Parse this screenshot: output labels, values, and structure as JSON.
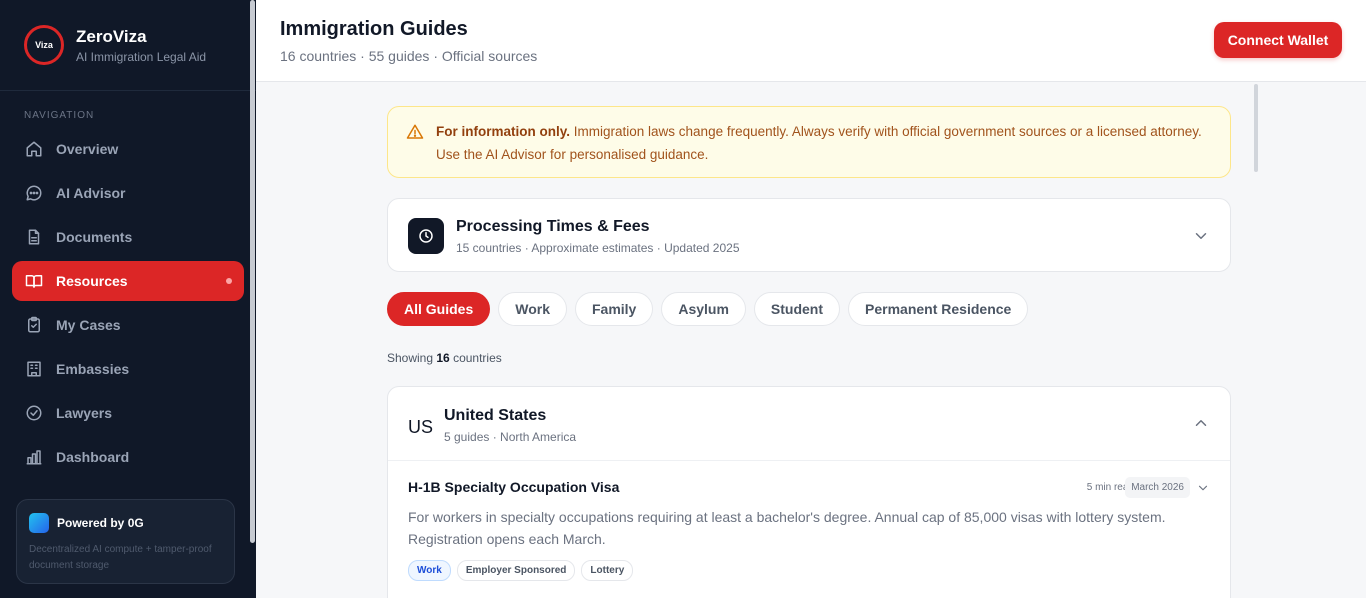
{
  "sidebar": {
    "logo_text": "Viza",
    "brand_name": "ZeroViza",
    "brand_sub": "AI Immigration Legal Aid",
    "nav_heading": "NAVIGATION",
    "items": [
      {
        "label": "Overview",
        "icon": "home-icon"
      },
      {
        "label": "AI Advisor",
        "icon": "chat-icon"
      },
      {
        "label": "Documents",
        "icon": "document-icon"
      },
      {
        "label": "Resources",
        "icon": "book-icon",
        "active": true
      },
      {
        "label": "My Cases",
        "icon": "clipboard-icon"
      },
      {
        "label": "Embassies",
        "icon": "building-icon"
      },
      {
        "label": "Lawyers",
        "icon": "check-circle-icon"
      },
      {
        "label": "Dashboard",
        "icon": "bar-chart-icon"
      }
    ],
    "powered": {
      "title": "Powered by 0G",
      "desc": "Decentralized AI compute + tamper-proof document storage"
    }
  },
  "header": {
    "title": "Immigration Guides",
    "subtitle": "16 countries · 55 guides · Official sources",
    "connect_label": "Connect Wallet"
  },
  "notice": {
    "bold": "For information only.",
    "text": "Immigration laws change frequently. Always verify with official government sources or a licensed attorney. Use the AI Advisor for personalised guidance."
  },
  "processing": {
    "title": "Processing Times & Fees",
    "subtitle": "15 countries · Approximate estimates · Updated 2025"
  },
  "filters": [
    "All Guides",
    "Work",
    "Family",
    "Asylum",
    "Student",
    "Permanent Residence"
  ],
  "showing": {
    "prefix": "Showing",
    "count": "16",
    "suffix": "countries"
  },
  "country": {
    "code": "US",
    "name": "United States",
    "subtitle": "5 guides · North America",
    "guide": {
      "title": "H-1B Specialty Occupation Visa",
      "read_time": "5 min read",
      "date": "March 2026",
      "description": "For workers in specialty occupations requiring at least a bachelor's degree. Annual cap of 85,000 visas with lottery system. Registration opens each March.",
      "tags": [
        "Work",
        "Employer Sponsored",
        "Lottery"
      ]
    }
  },
  "colors": {
    "accent": "#dc2626",
    "sidebar_bg": "#101828",
    "notice_bg": "#fefce8"
  }
}
